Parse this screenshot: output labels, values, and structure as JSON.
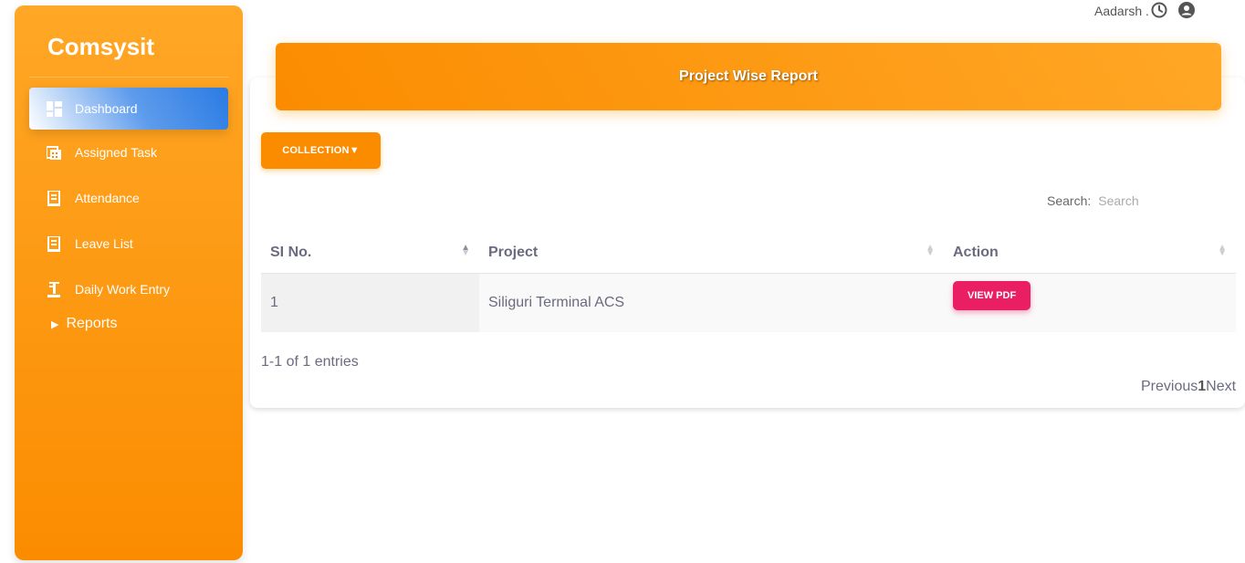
{
  "sidebar": {
    "brand": "Comsysit",
    "items": [
      {
        "label": "Dashboard",
        "icon": "dashboard-icon"
      },
      {
        "label": "Assigned Task",
        "icon": "task-icon"
      },
      {
        "label": "Attendance",
        "icon": "attendance-icon"
      },
      {
        "label": "Leave List",
        "icon": "leave-icon"
      },
      {
        "label": "Daily Work Entry",
        "icon": "work-entry-icon"
      }
    ],
    "reports_label": "Reports"
  },
  "topbar": {
    "username": "Aadarsh ."
  },
  "header": {
    "title": "Project Wise Report"
  },
  "collection_button": "COLLECTION▼",
  "search": {
    "label": "Search:",
    "placeholder": "Search"
  },
  "table": {
    "headers": [
      "SI No.",
      "Project",
      "Action"
    ],
    "rows": [
      {
        "si": "1",
        "project": "Siliguri Terminal ACS",
        "action": "VIEW PDF"
      }
    ]
  },
  "entries_text": "1-1 of 1 entries",
  "pagination": {
    "previous": "Previous",
    "current": "1",
    "next": "Next"
  },
  "colors": {
    "orange": "#fb8c00",
    "pink": "#e91e63",
    "active_blue": "#2a7be4"
  }
}
